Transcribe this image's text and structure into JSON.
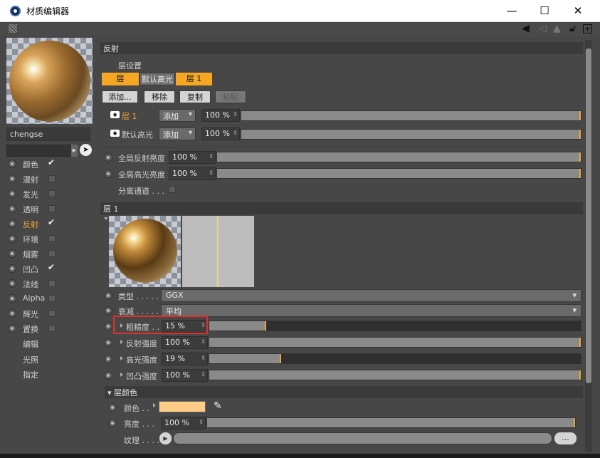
{
  "window": {
    "title": "材质编辑器",
    "minimize": "—",
    "maximize": "☐",
    "close": "✕"
  },
  "left": {
    "material_name": "chengse",
    "channels": [
      {
        "label": "颜色",
        "checked": true,
        "active": false
      },
      {
        "label": "漫射",
        "checked": false,
        "active": false
      },
      {
        "label": "发光",
        "checked": false,
        "active": false
      },
      {
        "label": "透明",
        "checked": false,
        "active": false
      },
      {
        "label": "反射",
        "checked": true,
        "active": true
      },
      {
        "label": "环境",
        "checked": false,
        "active": false
      },
      {
        "label": "烟雾",
        "checked": false,
        "active": false
      },
      {
        "label": "凹凸",
        "checked": true,
        "active": false
      },
      {
        "label": "法线",
        "checked": false,
        "active": false
      },
      {
        "label": "Alpha",
        "checked": false,
        "active": false
      },
      {
        "label": "辉光",
        "checked": false,
        "active": false
      },
      {
        "label": "置换",
        "checked": false,
        "active": false
      }
    ],
    "extras": [
      "编辑",
      "光照",
      "指定"
    ]
  },
  "reflect": {
    "header": "反射",
    "layer_settings": "层设置",
    "tabs": {
      "layer": "层",
      "default_specular": "默认高光",
      "layer1": "层 1"
    },
    "buttons": {
      "add": "添加...",
      "remove": "移除",
      "copy": "复制",
      "paste": "粘贴"
    },
    "layers": [
      {
        "name": "层 1",
        "mode": "添加",
        "value": "100 %"
      },
      {
        "name": "默认高光",
        "mode": "添加",
        "value": "100 %"
      }
    ],
    "global_reflect_label": "全局反射亮度",
    "global_reflect_value": "100 %",
    "global_spec_label": "全局高光亮度",
    "global_spec_value": "100 %",
    "separate_channels_label": "分离通道 . . ."
  },
  "layer1": {
    "header": "层 1",
    "type_label": "类型 . . . . . .",
    "type_value": "GGX",
    "atten_label": "衰减 . . . . . .",
    "atten_value": "平均",
    "roughness_label": "粗糙度 . .",
    "roughness_value": "15 %",
    "roughness": 0.15,
    "reflect_strength_label": "反射强度",
    "reflect_strength_value": "100 %",
    "spec_strength_label": "高光强度",
    "spec_strength_value": "19 %",
    "spec_strength": 0.19,
    "bump_strength_label": "凹凸强度",
    "bump_strength_value": "100 %"
  },
  "layer_color": {
    "header": "▾ 层颜色",
    "color_label": "颜色 . .",
    "color_hex": "#ffcc88",
    "brightness_label": "亮度 . . .",
    "brightness_value": "100 %",
    "texture_label": "纹理 . . . .",
    "texture_button": "..."
  }
}
